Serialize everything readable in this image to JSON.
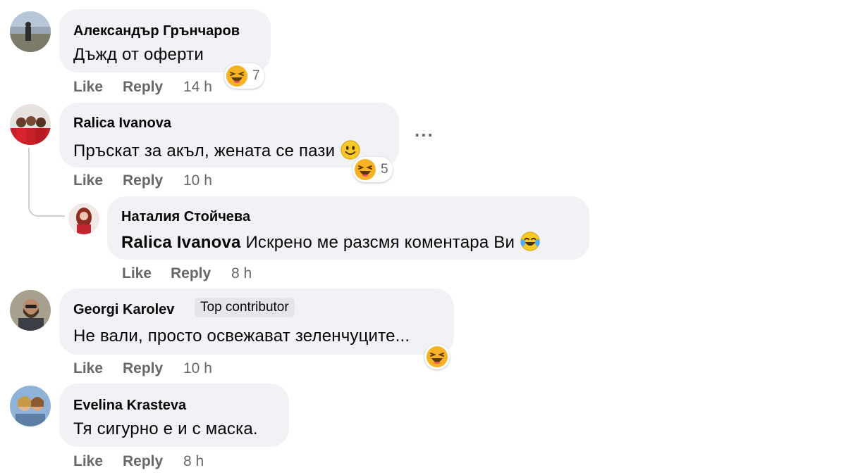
{
  "comments": [
    {
      "author": "Александър Грънчаров",
      "text": "Дъжд от оферти",
      "like_label": "Like",
      "reply_label": "Reply",
      "time": "14 h",
      "reaction": {
        "icon": "laughing-emoji-icon",
        "count": "7"
      }
    },
    {
      "author": "Ralica Ivanova",
      "text": "Пръскат за акъл, жената се пази",
      "like_label": "Like",
      "reply_label": "Reply",
      "time": "10 h",
      "reaction": {
        "icon": "laughing-emoji-icon",
        "count": "5"
      },
      "more_icon": "more-options-icon",
      "more_label": "...",
      "inline_emoji": "smiley-emoji-icon",
      "replies": [
        {
          "author": "Наталия Стойчева",
          "mention": "Ralica Ivanova",
          "text": "Искрено ме разсмя коментара Ви",
          "inline_emoji": "tears-of-joy-emoji-icon",
          "like_label": "Like",
          "reply_label": "Reply",
          "time": "8 h"
        }
      ]
    },
    {
      "author": "Georgi Karolev",
      "badge": "Top contributor",
      "text": "Не вали, просто освежават зеленчуците...",
      "like_label": "Like",
      "reply_label": "Reply",
      "time": "10 h",
      "reaction": {
        "icon": "laughing-emoji-icon",
        "count": ""
      }
    },
    {
      "author": "Evelina Krasteva",
      "text": "Тя сигурно е и с маска.",
      "like_label": "Like",
      "reply_label": "Reply",
      "time": "8 h"
    }
  ],
  "colors": {
    "bubble": "#f0f2f5",
    "action_text": "#65676b",
    "text": "#050505",
    "badge_bg": "#e4e6eb"
  }
}
